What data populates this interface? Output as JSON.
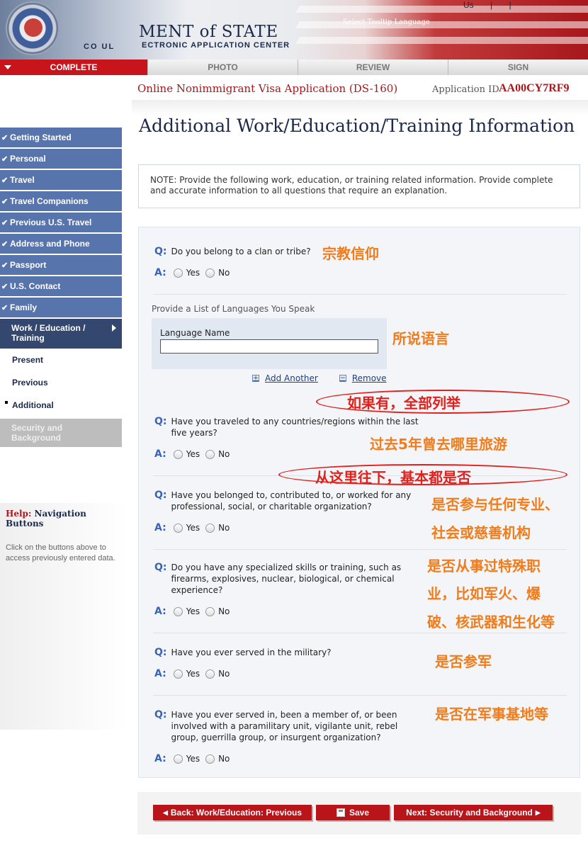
{
  "header": {
    "dept_title": "MENT of STATE",
    "center_title": "ECTRONIC APPLICATION CENTER",
    "consular_text": "CO UL",
    "tooltip_language": "Select Tooltip Language",
    "top_links": [
      "Us",
      "|",
      "|"
    ]
  },
  "steps": {
    "complete": "COMPLETE",
    "photo": "PHOTO",
    "review": "REVIEW",
    "sign": "SIGN"
  },
  "application": {
    "title": "Online Nonimmigrant Visa Application (DS-160)",
    "id_label": "Application ID",
    "id_value": "AA00CY7RF9"
  },
  "page_title": "Additional Work/Education/Training Information",
  "note": "NOTE: Provide the following work, education, or training related information. Provide complete and accurate information to all questions that require an explanation.",
  "sidebar": {
    "completed": [
      "Getting Started",
      "Personal",
      "Travel",
      "Travel Companions",
      "Previous U.S. Travel",
      "Address and Phone",
      "Passport",
      "U.S. Contact",
      "Family"
    ],
    "current": "Work / Education / Training",
    "sub_items": [
      "Present",
      "Previous",
      "Additional"
    ],
    "disabled": "Security and Background"
  },
  "help": {
    "prefix": "Help:",
    "title": "Navigation Buttons",
    "text": "Click on the buttons above to access previously entered data."
  },
  "labels": {
    "q": "Q:",
    "a": "A:",
    "yes": "Yes",
    "no": "No"
  },
  "questions": [
    "Do you belong to a clan or tribe?",
    "Have you traveled to any countries/regions within the last five years?",
    "Have you belonged to, contributed to, or worked for any professional, social, or charitable organization?",
    "Do you have any specialized skills or training, such as firearms, explosives, nuclear, biological, or chemical experience?",
    "Have you ever served in the military?",
    "Have you ever served in, been a member of, or been involved with a paramilitary unit, vigilante unit, rebel group, guerrilla group, or insurgent organization?"
  ],
  "languages": {
    "heading": "Provide a List of Languages You Speak",
    "field_label": "Language Name",
    "field_value": "",
    "add_another": "Add Another",
    "remove": "Remove"
  },
  "buttons": {
    "back": "Back: Work/Education: Previous",
    "save": "Save",
    "next": "Next: Security and Background"
  },
  "annotations": {
    "religion": "宗教信仰",
    "languages": "所说语言",
    "list_all": "如果有，全部列举",
    "travel": "过去5年曾去哪里旅游",
    "mostly_no": "从这里往下，基本都是否",
    "org_line1": "是否参与任何专业、",
    "org_line2": "社会或慈善机构",
    "skills_line1": "是否从事过特殊职",
    "skills_line2": "业，比如军火、爆",
    "skills_line3": "破、核武器和生化等",
    "military": "是否参军",
    "paramilitary": "是否在军事基地等"
  }
}
